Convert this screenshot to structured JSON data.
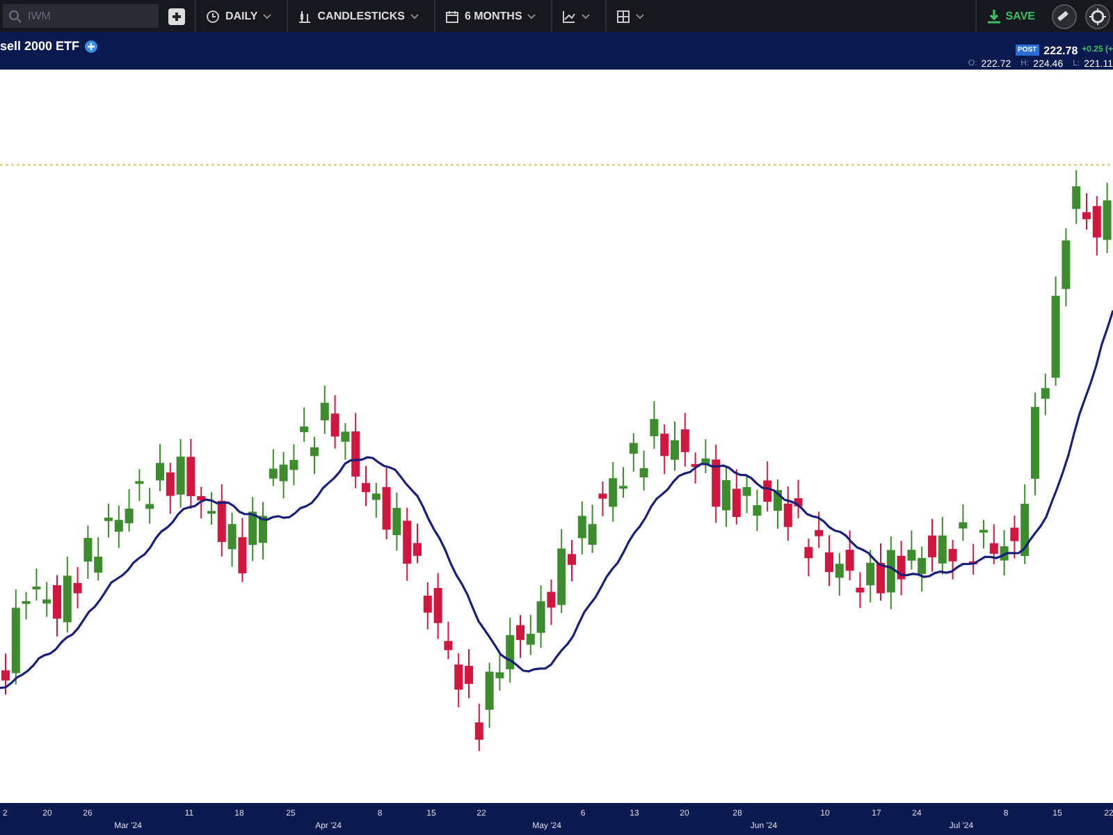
{
  "toolbar": {
    "search": {
      "placeholder": "IWM"
    },
    "dropdowns": [
      {
        "kind": "clock",
        "label": "DAILY"
      },
      {
        "kind": "candles",
        "label": "CANDLESTICKS"
      },
      {
        "kind": "calendar",
        "label": "6 MONTHS"
      },
      {
        "kind": "indicator"
      },
      {
        "kind": "layout"
      }
    ],
    "save_button": "SAVE"
  },
  "header": {
    "title": "sell 2000 ETF",
    "session_badge": "POST",
    "price": "222.78",
    "change": "+0.25 (+",
    "ohlc": [
      {
        "label": "O:",
        "value": "222.72"
      },
      {
        "label": "H:",
        "value": "224.46"
      },
      {
        "label": "L:",
        "value": "221.11"
      }
    ]
  },
  "x_axis": {
    "days": [
      "2",
      "20",
      "26",
      "11",
      "18",
      "25",
      "8",
      "15",
      "22",
      "6",
      "13",
      "20",
      "28",
      "10",
      "17",
      "24",
      "8",
      "15",
      "22"
    ],
    "months": [
      "Mar '24",
      "Apr '24",
      "May '24",
      "Jun '24",
      "Jul '24"
    ]
  }
}
